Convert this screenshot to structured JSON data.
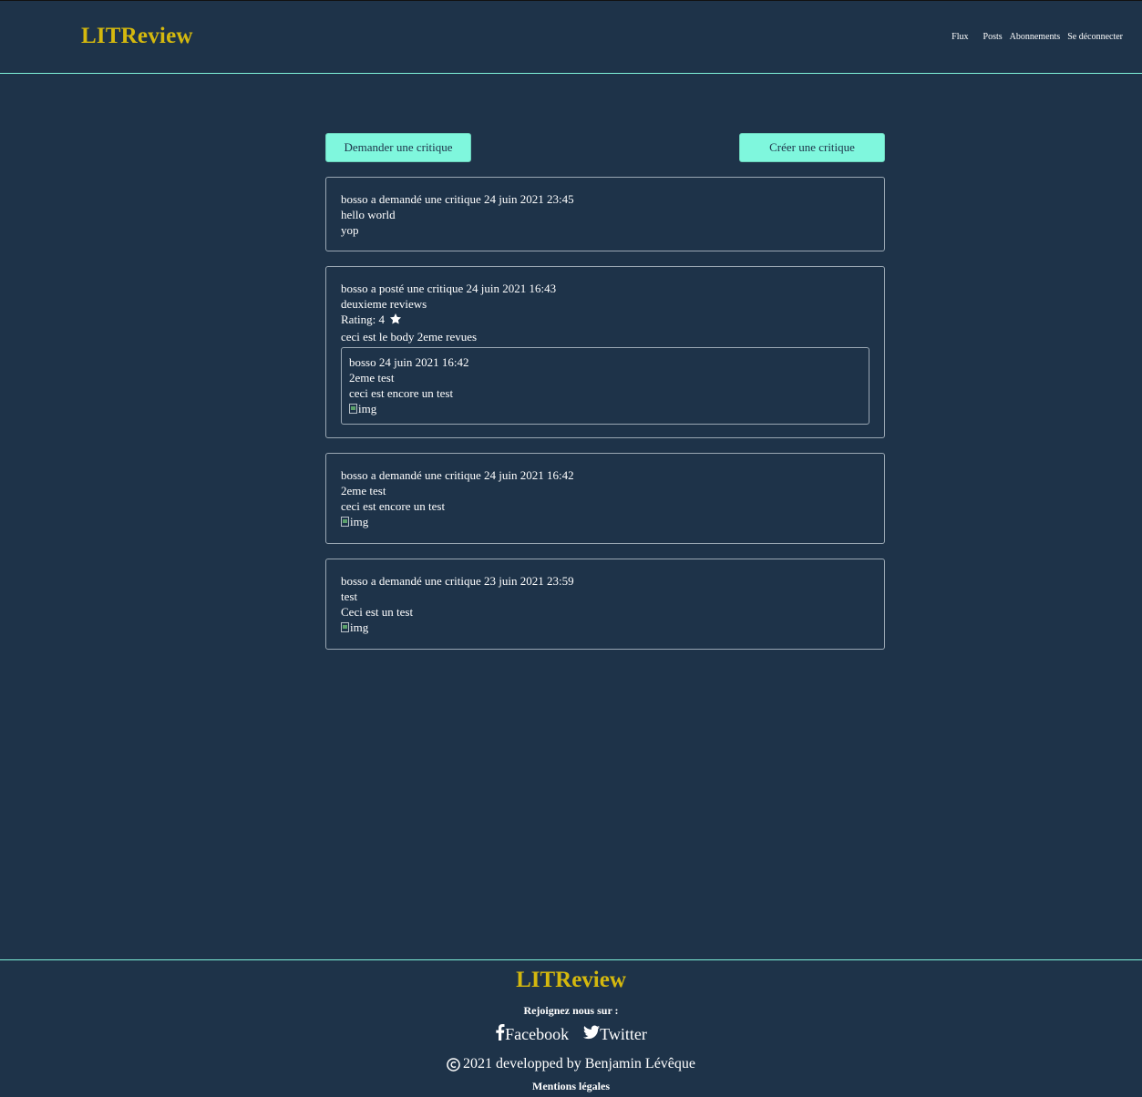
{
  "header": {
    "brand": "LITReview",
    "nav": {
      "flux": "Flux",
      "posts": "Posts",
      "abonnements": "Abonnements",
      "logout": "Se déconnecter"
    }
  },
  "actions": {
    "ask_review": "Demander une critique",
    "create_review": "Créer une critique"
  },
  "feed": {
    "card1": {
      "header": "bosso a demandé une critique 24 juin 2021 23:45",
      "title": "hello world",
      "description": "yop"
    },
    "card2": {
      "header": "bosso a posté une critique 24 juin 2021 16:43",
      "headline": "deuxieme reviews",
      "rating_label": "Rating: 4",
      "rating": 4,
      "body": "ceci est le body 2eme revues",
      "ticket": {
        "header": "bosso 24 juin 2021 16:42",
        "title": "2eme test",
        "description": "ceci est encore un test",
        "img_alt": "img"
      }
    },
    "card3": {
      "header": "bosso a demandé une critique 24 juin 2021 16:42",
      "title": "2eme test",
      "description": "ceci est encore un test",
      "img_alt": "img"
    },
    "card4": {
      "header": "bosso a demandé une critique 23 juin 2021 23:59",
      "title": "test",
      "description": "Ceci est un test",
      "img_alt": "img"
    }
  },
  "footer": {
    "brand": "LITReview",
    "join": "Rejoignez nous sur :",
    "facebook": "Facebook",
    "twitter": "Twitter",
    "copyright": "2021 developped by Benjamin Lévêque",
    "legal": "Mentions légales"
  },
  "colors": {
    "background": "#1e3349",
    "accent": "#7ff7dd",
    "brand": "#d4b80e"
  }
}
